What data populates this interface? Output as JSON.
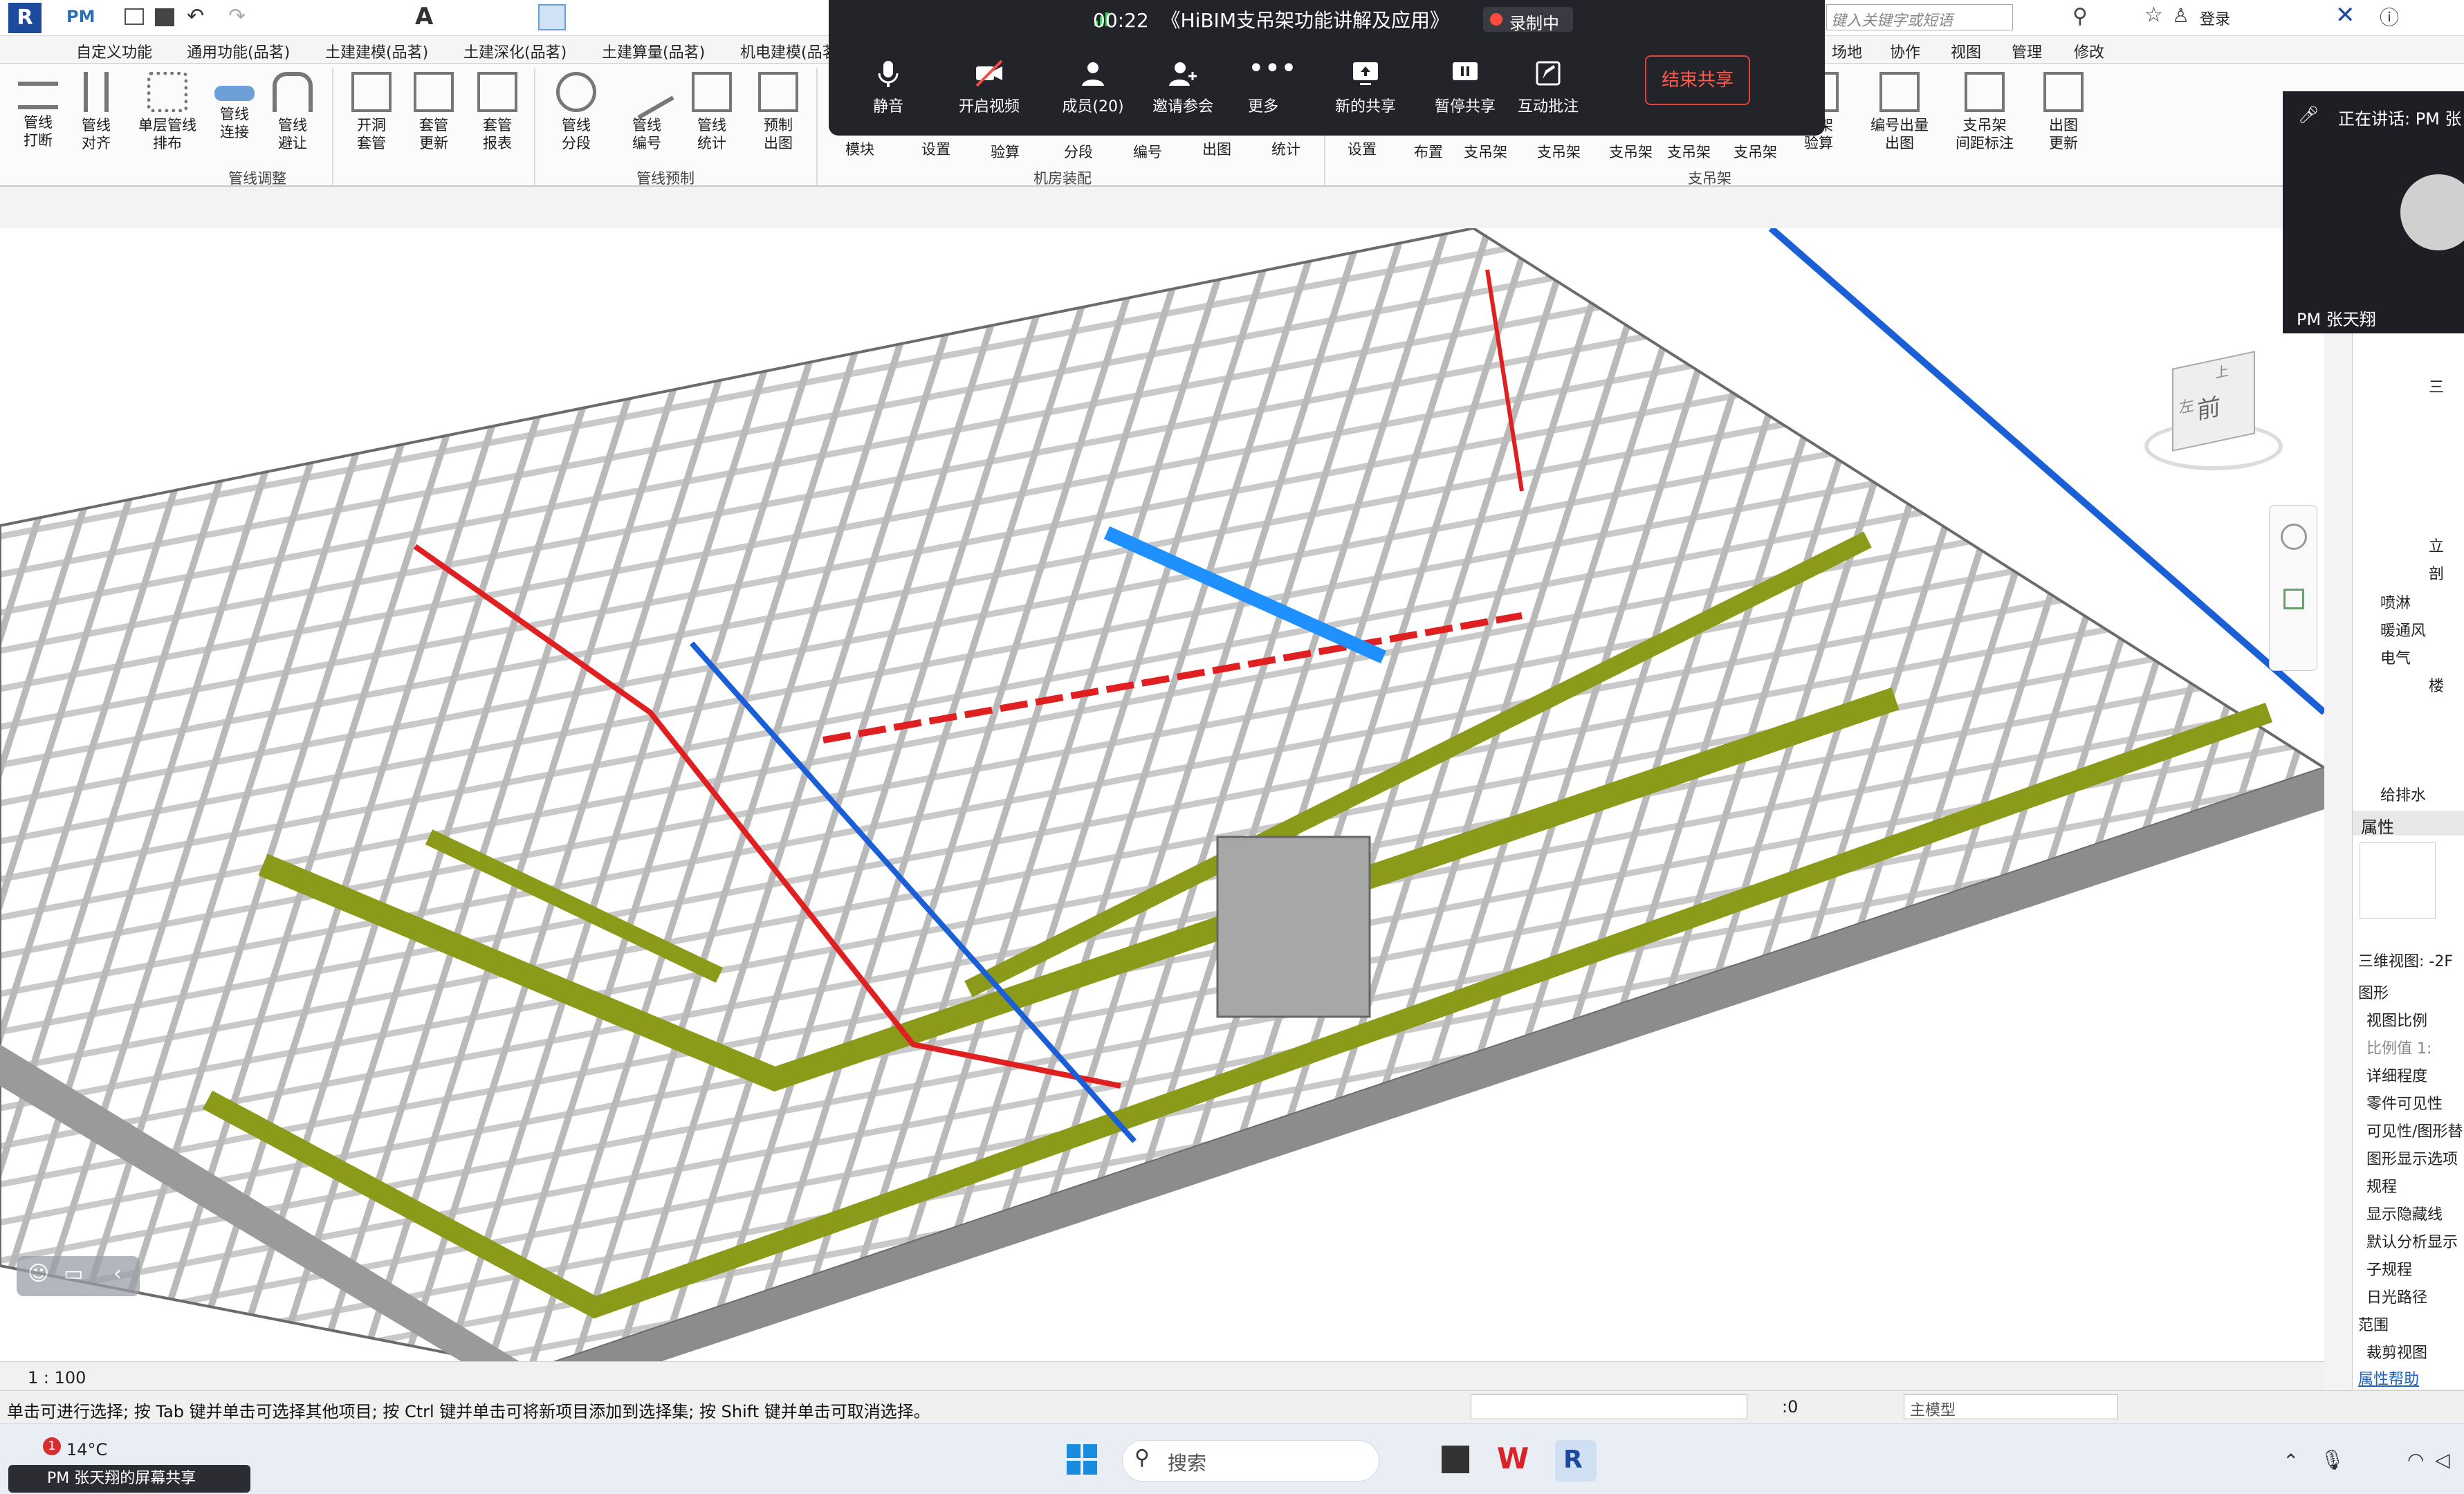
{
  "app": {
    "quick_access_label": "PM",
    "search_placeholder": "键入关键字或短语",
    "login_label": "登录",
    "menu_tabs": [
      "自定义功能",
      "通用功能(品茗)",
      "土建建模(品茗)",
      "土建深化(品茗)",
      "土建算量(品茗)",
      "机电建模(品茗)",
      "场地",
      "协作",
      "视图",
      "管理",
      "修改"
    ]
  },
  "ribbon": {
    "buttons_left": [
      {
        "label": "管线\n打断"
      },
      {
        "label": "管线\n对齐"
      },
      {
        "label": "单层管线\n排布"
      },
      {
        "label": "管线\n连接"
      },
      {
        "label": "管线\n避让"
      },
      {
        "label": "开洞\n套管"
      },
      {
        "label": "套管\n更新"
      },
      {
        "label": "套管\n报表"
      },
      {
        "label": "管线\n分段"
      },
      {
        "label": "管线\n编号"
      },
      {
        "label": "管线\n统计"
      },
      {
        "label": "预制\n出图"
      }
    ],
    "buttons_mid": [
      "模块",
      "设置",
      "验算",
      "分段",
      "编号",
      "出图",
      "统计",
      "设置",
      "布置",
      "支吊架",
      "支吊架",
      "支吊架",
      "支吊架",
      "支吊架"
    ],
    "buttons_right": [
      {
        "label": "吊架\n验算"
      },
      {
        "label": "编号出量\n出图"
      },
      {
        "label": "支吊架\n间距标注"
      },
      {
        "label": "出图\n更新"
      }
    ],
    "panels": [
      "管线调整",
      "管线预制",
      "机房装配",
      "支吊架"
    ]
  },
  "meeting": {
    "signal": "signal-icon",
    "time": "00:22",
    "title": "《HiBIM支吊架功能讲解及应用》",
    "recording": "录制中",
    "buttons": [
      "静音",
      "开启视频",
      "成员(20)",
      "邀请参会",
      "更多",
      "新的共享",
      "暂停共享",
      "互动批注"
    ],
    "end_share": "结束共享",
    "speaking_label": "正在讲话: PM 张",
    "speaker_name": "PM 张天翔"
  },
  "viewcube": {
    "top": "上",
    "front": "前",
    "left": "左"
  },
  "project_browser": {
    "items": [
      "三",
      "立",
      "剖",
      "喷淋",
      "暖通风",
      "电气",
      "楼",
      "给排水"
    ]
  },
  "properties": {
    "title": "属性",
    "view_type": "三维视图: -2F",
    "rows": [
      "图形",
      "视图比例",
      "比例值 1:",
      "详细程度",
      "零件可见性",
      "可见性/图形替",
      "图形显示选项",
      "规程",
      "显示隐藏线",
      "默认分析显示",
      "子规程",
      "日光路径",
      "范围",
      "裁剪视图"
    ],
    "help": "属性帮助"
  },
  "view": {
    "scale": "1 : 100"
  },
  "status": {
    "hint": "单击可进行选择; 按 Tab 键并单击可选择其他项目; 按 Ctrl 键并单击可将新项目添加到选择集; 按 Shift 键并单击可取消选择。",
    "selected_count": ":0",
    "model_name": "主模型"
  },
  "taskbar": {
    "weather": "14°C",
    "notification_count": "1",
    "search": "搜索",
    "screen_share": "PM 张天翔的屏幕共享"
  }
}
